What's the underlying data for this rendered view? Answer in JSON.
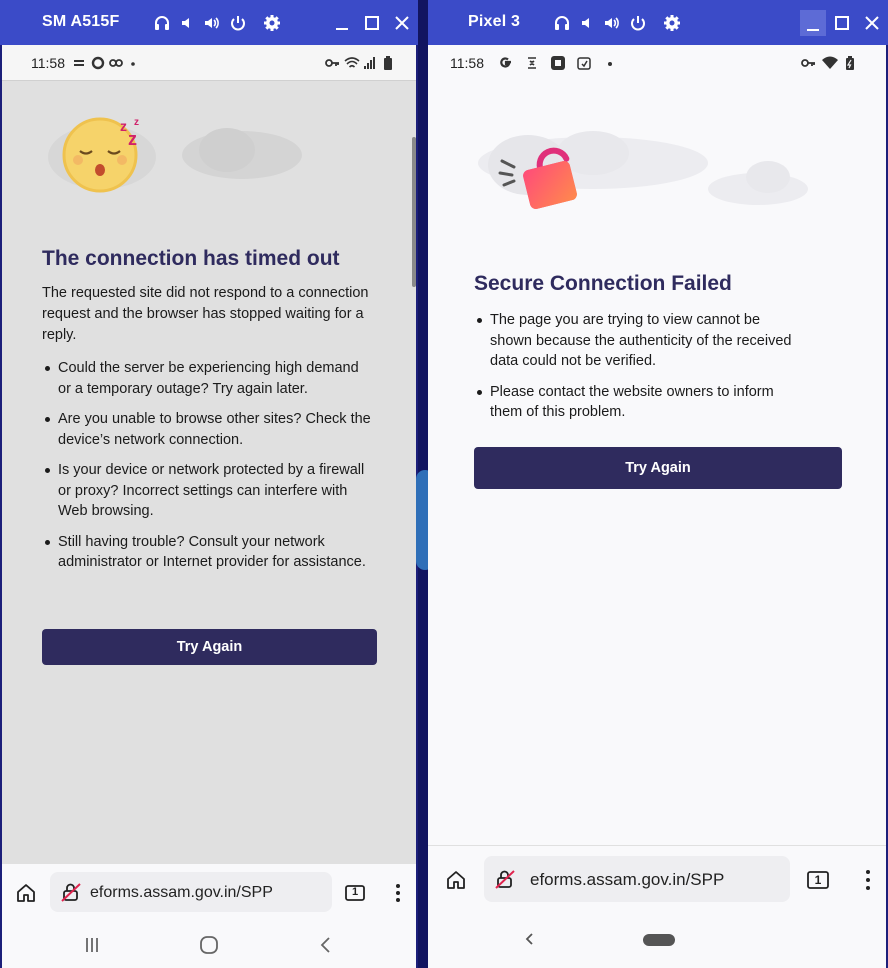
{
  "left": {
    "window_title": "SM A515F",
    "status_time": "11:58",
    "error_title": "The connection has timed out",
    "error_intro": "The requested site did not respond to a connection request and the browser has stopped waiting for a reply.",
    "bullets": [
      "Could the server be experiencing high demand or a temporary outage? Try again later.",
      "Are you unable to browse other sites? Check the device’s network connection.",
      "Is your device or network protected by a firewall or proxy? Incorrect settings can interfere with Web browsing.",
      "Still having trouble? Consult your network administrator or Internet provider for assistance."
    ],
    "button_label": "Try Again",
    "url": "eforms.assam.gov.in/SPP",
    "tab_count": "1"
  },
  "right": {
    "window_title": "Pixel 3",
    "status_time": "11:58",
    "error_title": "Secure Connection Failed",
    "bullets": [
      "The page you are trying to view cannot be shown because the authenticity of the received data could not be verified.",
      "Please contact the website owners to inform them of this problem."
    ],
    "button_label": "Try Again",
    "url": "eforms.assam.gov.in/SPP",
    "tab_count": "1"
  },
  "colors": {
    "titlebar": "#3b4bc8",
    "button": "#2f2b5e",
    "heading": "#2f2b5e"
  }
}
